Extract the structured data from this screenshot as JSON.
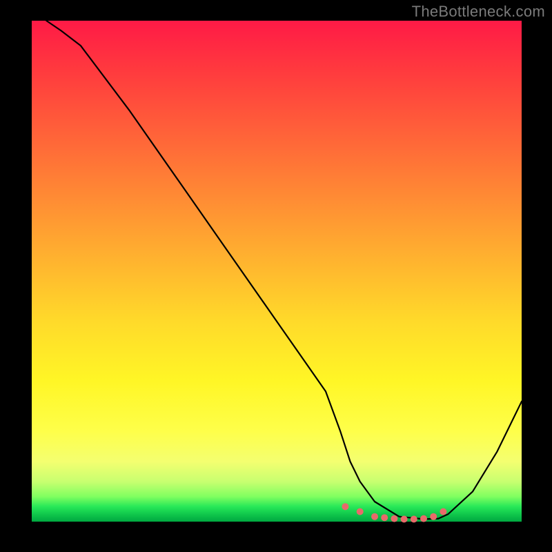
{
  "watermark": "TheBottleneck.com",
  "colors": {
    "background": "#000000",
    "gradient_top": "#ff1a46",
    "gradient_mid": "#ffda2a",
    "gradient_bottom": "#00a840",
    "curve": "#000000",
    "dots": "#e86a6a"
  },
  "chart_data": {
    "type": "line",
    "title": "",
    "xlabel": "",
    "ylabel": "",
    "xlim": [
      0,
      100
    ],
    "ylim": [
      0,
      100
    ],
    "series": [
      {
        "name": "bottleneck-curve",
        "x": [
          3,
          6,
          10,
          20,
          30,
          40,
          50,
          60,
          63,
          65,
          67,
          70,
          75,
          80,
          83,
          85,
          90,
          95,
          100
        ],
        "y": [
          100,
          98,
          95,
          82,
          68,
          54,
          40,
          26,
          18,
          12,
          8,
          4,
          1,
          0.5,
          0.6,
          1.5,
          6,
          14,
          24
        ]
      }
    ],
    "highlight_points": {
      "name": "near-zero-range",
      "x": [
        64,
        67,
        70,
        72,
        74,
        76,
        78,
        80,
        82,
        84
      ],
      "y": [
        3,
        2,
        1,
        0.8,
        0.6,
        0.5,
        0.5,
        0.6,
        1,
        2
      ]
    }
  }
}
